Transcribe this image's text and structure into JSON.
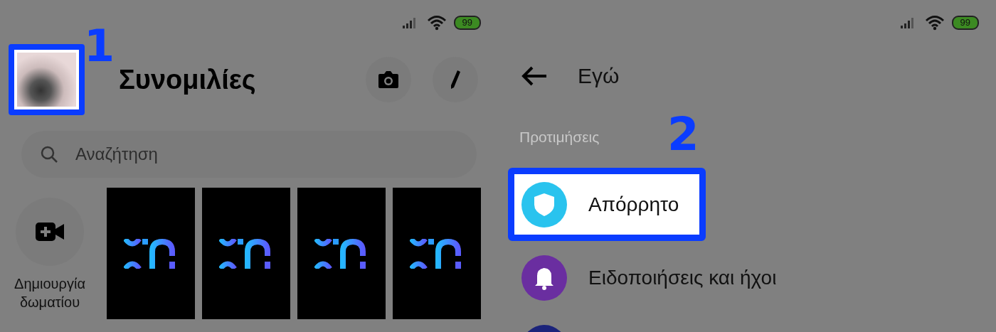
{
  "left_screen": {
    "status_bar": {
      "battery": "99"
    },
    "avatar": {
      "highlighted": true,
      "step": "1"
    },
    "title": "Συνομιλίες",
    "search": {
      "placeholder": "Αναζήτηση"
    },
    "create_room": {
      "label": "Δημιουργία δωματίου"
    },
    "stories": [
      {
        "kind": "logo"
      },
      {
        "kind": "logo"
      },
      {
        "kind": "logo"
      },
      {
        "kind": "logo"
      }
    ]
  },
  "right_screen": {
    "status_bar": {
      "battery": "99"
    },
    "title": "Εγώ",
    "section": "Προτιμήσεις",
    "step": "2",
    "items": [
      {
        "kind": "shield",
        "label": "Απόρρητο",
        "color": "#29c3ee",
        "highlighted": true
      },
      {
        "kind": "bell",
        "label": "Ειδοποιήσεις και ήχοι",
        "color": "#6a2ea0",
        "highlighted": false
      },
      {
        "kind": "plain",
        "color": "#1b237a",
        "highlighted": false
      }
    ]
  }
}
